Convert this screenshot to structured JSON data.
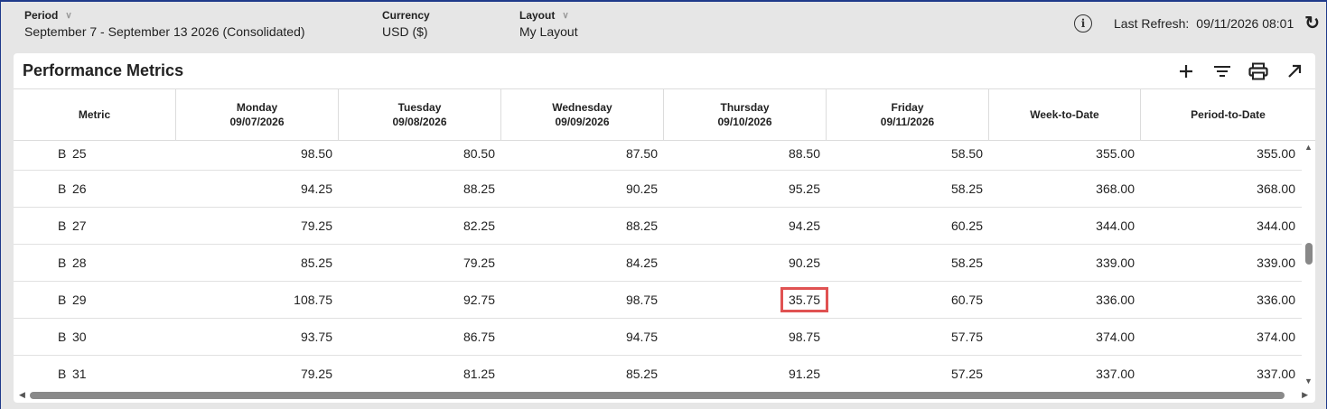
{
  "filters": {
    "period_label": "Period",
    "period_value": "September 7 - September 13 2026 (Consolidated)",
    "currency_label": "Currency",
    "currency_value": "USD ($)",
    "layout_label": "Layout",
    "layout_value": "My Layout"
  },
  "refresh": {
    "label": "Last Refresh:",
    "value": "09/11/2026 08:01"
  },
  "card": {
    "title": "Performance Metrics"
  },
  "columns": [
    {
      "line1": "Metric",
      "line2": ""
    },
    {
      "line1": "Monday",
      "line2": "09/07/2026"
    },
    {
      "line1": "Tuesday",
      "line2": "09/08/2026"
    },
    {
      "line1": "Wednesday",
      "line2": "09/09/2026"
    },
    {
      "line1": "Thursday",
      "line2": "09/10/2026"
    },
    {
      "line1": "Friday",
      "line2": "09/11/2026"
    },
    {
      "line1": "Week-to-Date",
      "line2": ""
    },
    {
      "line1": "Period-to-Date",
      "line2": ""
    }
  ],
  "rows": [
    {
      "prefix": "B",
      "id": "25",
      "mon": "98.50",
      "tue": "80.50",
      "wed": "87.50",
      "thu": "88.50",
      "fri": "58.50",
      "wtd": "355.00",
      "ptd": "355.00"
    },
    {
      "prefix": "B",
      "id": "26",
      "mon": "94.25",
      "tue": "88.25",
      "wed": "90.25",
      "thu": "95.25",
      "fri": "58.25",
      "wtd": "368.00",
      "ptd": "368.00"
    },
    {
      "prefix": "B",
      "id": "27",
      "mon": "79.25",
      "tue": "82.25",
      "wed": "88.25",
      "thu": "94.25",
      "fri": "60.25",
      "wtd": "344.00",
      "ptd": "344.00"
    },
    {
      "prefix": "B",
      "id": "28",
      "mon": "85.25",
      "tue": "79.25",
      "wed": "84.25",
      "thu": "90.25",
      "fri": "58.25",
      "wtd": "339.00",
      "ptd": "339.00"
    },
    {
      "prefix": "B",
      "id": "29",
      "mon": "108.75",
      "tue": "92.75",
      "wed": "98.75",
      "thu": "35.75",
      "fri": "60.75",
      "wtd": "336.00",
      "ptd": "336.00"
    },
    {
      "prefix": "B",
      "id": "30",
      "mon": "93.75",
      "tue": "86.75",
      "wed": "94.75",
      "thu": "98.75",
      "fri": "57.75",
      "wtd": "374.00",
      "ptd": "374.00"
    },
    {
      "prefix": "B",
      "id": "31",
      "mon": "79.25",
      "tue": "81.25",
      "wed": "85.25",
      "thu": "91.25",
      "fri": "57.25",
      "wtd": "337.00",
      "ptd": "337.00"
    }
  ],
  "highlight": {
    "row": 4,
    "column": "thu",
    "color": "#e05252"
  },
  "icons": {
    "info": "info-icon",
    "refresh": "refresh-icon",
    "add": "plus-icon",
    "filter": "filter-icon",
    "print": "print-icon",
    "expand": "expand-icon"
  },
  "colors": {
    "frame_border": "#1f3a8a",
    "background": "#e6e6e6",
    "highlight": "#e05252"
  }
}
